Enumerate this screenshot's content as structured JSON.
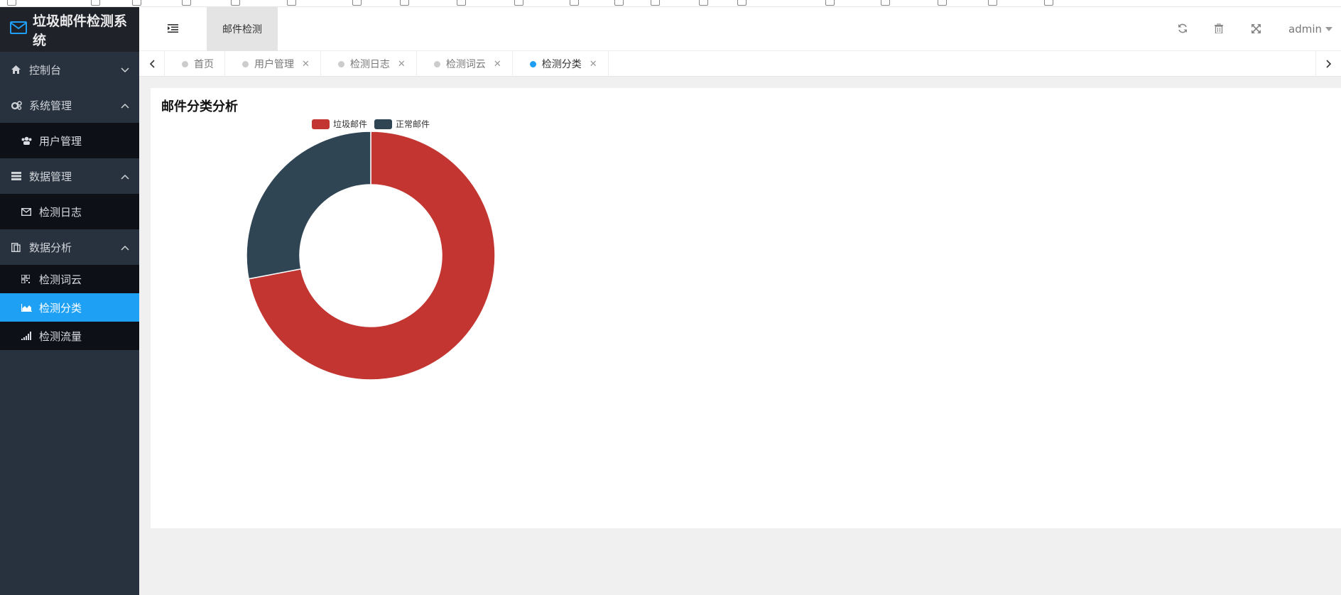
{
  "app": {
    "title": "垃圾邮件检测系统"
  },
  "sidebar": {
    "items": [
      {
        "label": "控制台",
        "icon": "home-icon",
        "type": "group",
        "expanded": false
      },
      {
        "label": "系统管理",
        "icon": "gears-icon",
        "type": "group",
        "expanded": true
      },
      {
        "label": "用户管理",
        "icon": "users-icon",
        "type": "sub"
      },
      {
        "label": "数据管理",
        "icon": "server-icon",
        "type": "group",
        "expanded": true
      },
      {
        "label": "检测日志",
        "icon": "envelope-icon",
        "type": "sub"
      },
      {
        "label": "数据分析",
        "icon": "book-icon",
        "type": "group",
        "expanded": true
      },
      {
        "label": "检测词云",
        "icon": "qrcode-icon",
        "type": "sub"
      },
      {
        "label": "检测分类",
        "icon": "area-chart-icon",
        "type": "sub",
        "active": true
      },
      {
        "label": "检测流量",
        "icon": "signal-icon",
        "type": "sub"
      }
    ]
  },
  "header": {
    "top_tab": "邮件检测",
    "user": "admin"
  },
  "tabs": [
    {
      "label": "首页",
      "closable": false
    },
    {
      "label": "用户管理",
      "closable": true
    },
    {
      "label": "检测日志",
      "closable": true
    },
    {
      "label": "检测词云",
      "closable": true
    },
    {
      "label": "检测分类",
      "closable": true,
      "active": true
    }
  ],
  "card": {
    "title": "邮件分类分析"
  },
  "chart_data": {
    "type": "pie",
    "donut": true,
    "title": "邮件分类分析",
    "legend_position": "top-left",
    "series": [
      {
        "name": "垃圾邮件",
        "value": 72,
        "color": "#c23531"
      },
      {
        "name": "正常邮件",
        "value": 28,
        "color": "#2f4554"
      }
    ]
  },
  "colors": {
    "sidebar_bg": "#28323e",
    "sidebar_active": "#1ea0f5",
    "accent": "#1e9ff5"
  }
}
